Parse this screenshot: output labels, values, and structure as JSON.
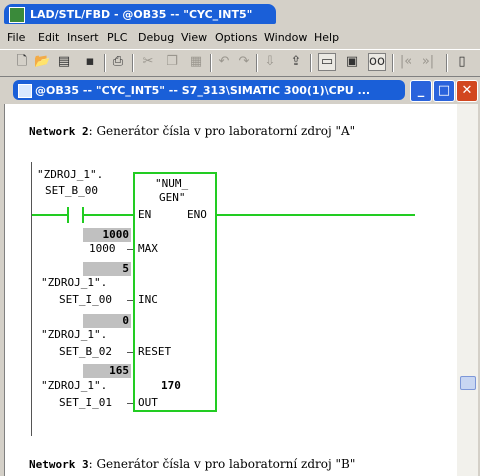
{
  "app": {
    "title": "LAD/STL/FBD  - @OB35 -- \"CYC_INT5\""
  },
  "menu": [
    "File",
    "Edit",
    "Insert",
    "PLC",
    "Debug",
    "View",
    "Options",
    "Window",
    "Help"
  ],
  "toolbar_icons": [
    "new-icon",
    "open-icon",
    "accessible-nodes-icon",
    "save-icon",
    "print-icon",
    "cut-icon",
    "copy-icon",
    "paste-icon",
    "undo-icon",
    "redo-icon",
    "download-icon",
    "upload-icon",
    "overview-icon",
    "monitor-icon",
    "glasses-icon",
    "network-prev-icon",
    "network-next-icon",
    "panel-icon"
  ],
  "child": {
    "title": "@OB35 -- \"CYC_INT5\" -- S7_313\\SIMATIC 300(1)\\CPU ...",
    "min": "_",
    "max": "□",
    "close": "✕"
  },
  "network2": {
    "title_label": "Network 2",
    "title_text": ": Generátor čísla v pro laboratorní zdroj \"A\"",
    "contact": {
      "line1": "\"ZDROJ_1\".",
      "line2": "SET_B_00"
    },
    "block": {
      "name1": "\"NUM_",
      "name2": "GEN\"",
      "en": "EN",
      "eno": "ENO",
      "max": "MAX",
      "inc": "INC",
      "reset": "RESET",
      "out": "OUT"
    },
    "max_monitor": "1000",
    "max_param": "1000",
    "inc_monitor": "5",
    "inc_line1": "\"ZDROJ_1\".",
    "inc_line2": "SET_I_00",
    "reset_monitor": "0",
    "reset_line1": "\"ZDROJ_1\".",
    "reset_line2": "SET_B_02",
    "out_monitor": "165",
    "out_line1": "\"ZDROJ_1\".",
    "out_line2": "SET_I_01",
    "out_value": "170"
  },
  "network3": {
    "title_label": "Network 3",
    "title_text": ": Generátor čísla v pro laboratorní zdroj \"B\""
  },
  "colors": {
    "title_blue": "#1a5fd8",
    "power_flow": "#22cc22",
    "monitor_gray": "#c0c0c0"
  }
}
